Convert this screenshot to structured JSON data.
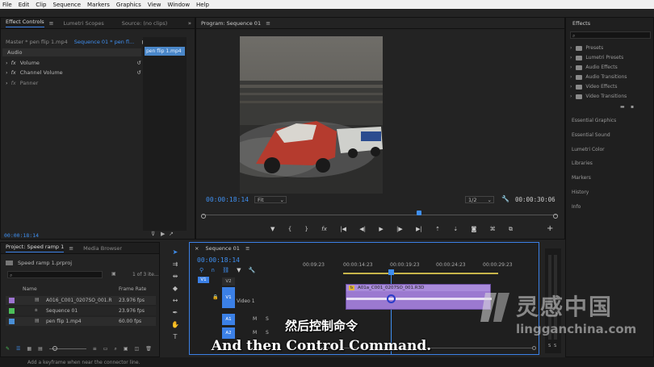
{
  "menu": [
    "File",
    "Edit",
    "Clip",
    "Sequence",
    "Markers",
    "Graphics",
    "View",
    "Window",
    "Help"
  ],
  "effect_controls": {
    "tabs": [
      "Effect Controls",
      "Lumetri Scopes",
      "Source: (no clips)"
    ],
    "master": "Master * pen flip 1.mp4",
    "sequence": "Sequence 01 * pen fl...",
    "section": "Audio",
    "items": [
      "Volume",
      "Channel Volume",
      "Panner"
    ],
    "clip_label": "pen flip 1.mp4",
    "timecode": "00:00:18:14"
  },
  "program": {
    "title": "Program: Sequence 01",
    "timecode": "00:00:18:14",
    "fit": "Fit",
    "resolution": "1/2",
    "duration": "00:00:30:06"
  },
  "effects": {
    "title": "Effects",
    "folders": [
      "Presets",
      "Lumetri Presets",
      "Audio Effects",
      "Audio Transitions",
      "Video Effects",
      "Video Transitions"
    ],
    "panels": [
      "Essential Graphics",
      "Essential Sound",
      "Lumetri Color",
      "Libraries",
      "Markers",
      "History",
      "Info"
    ]
  },
  "project": {
    "tabs": [
      "Project: Speed ramp 1",
      "Media Browser"
    ],
    "file": "Speed ramp 1.prproj",
    "count": "1 of 3 ite...",
    "col_name": "Name",
    "col_rate": "Frame Rate",
    "rows": [
      {
        "name": "A016_C001_0207SO_001.R",
        "rate": "23.976 fps",
        "color": "#9d74d1"
      },
      {
        "name": "Sequence 01",
        "rate": "23.976 fps",
        "color": "#4cbf59"
      },
      {
        "name": "pen flip 1.mp4",
        "rate": "60.00 fps",
        "color": "#4a8fd6"
      }
    ]
  },
  "timeline": {
    "title": "Sequence 01",
    "timecode": "00:00:18:14",
    "ruler": [
      "00:09:23",
      "00:00:14:23",
      "00:00:19:23",
      "00:00:24:23",
      "00:00:29:23"
    ],
    "tracks": {
      "v2": "V2",
      "v1": "V1",
      "video_label": "Video 1",
      "a1": "A1",
      "a2": "A2",
      "src_v1": "V1",
      "m": "M",
      "s": "S"
    },
    "clip": "A01a_C001_0207SO_001.R3D"
  },
  "meter": [
    "S",
    "S"
  ],
  "subtitle_cn": "然后控制命令",
  "subtitle_en": "And then Control Command.",
  "status": "Add a keyframe when near the connector line.",
  "watermark": {
    "cn": "灵感中国",
    "en": "lingganchina.com"
  }
}
